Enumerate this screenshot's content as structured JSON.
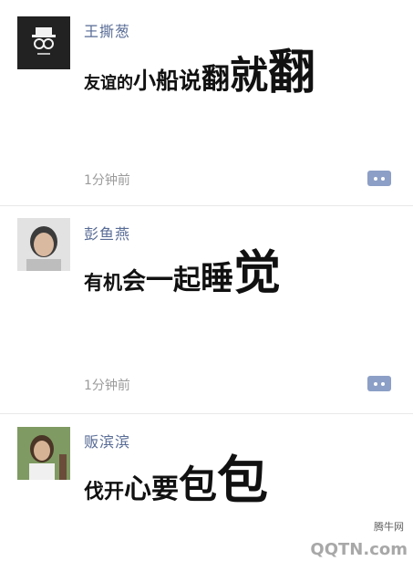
{
  "feed": {
    "moments": [
      {
        "username": "王撕葱",
        "text_segments": [
          "友谊的",
          "小船",
          "说",
          "翻",
          "就",
          "翻"
        ],
        "time": "1分钟前",
        "avatar_icon": "hatted-figure-avatar-icon",
        "comment_icon": "comment-bubble-icon"
      },
      {
        "username": "彭鱼燕",
        "text_segments": [
          "有机",
          "会",
          "一起",
          "睡",
          "觉"
        ],
        "time": "1分钟前",
        "avatar_icon": "user-photo-avatar-icon",
        "comment_icon": "comment-bubble-icon"
      },
      {
        "username": "贩滨滨",
        "text_segments": [
          "伐开",
          "心",
          "要",
          "包",
          "包"
        ],
        "avatar_icon": "user-photo-avatar-icon"
      }
    ]
  },
  "watermark": {
    "site_cn": "腾牛网",
    "site_en": "QQTN.com"
  },
  "colors": {
    "username": "#576b95",
    "time": "#9b9b9b",
    "comment_button": "#8c9fc6",
    "post_text": "#111111"
  }
}
